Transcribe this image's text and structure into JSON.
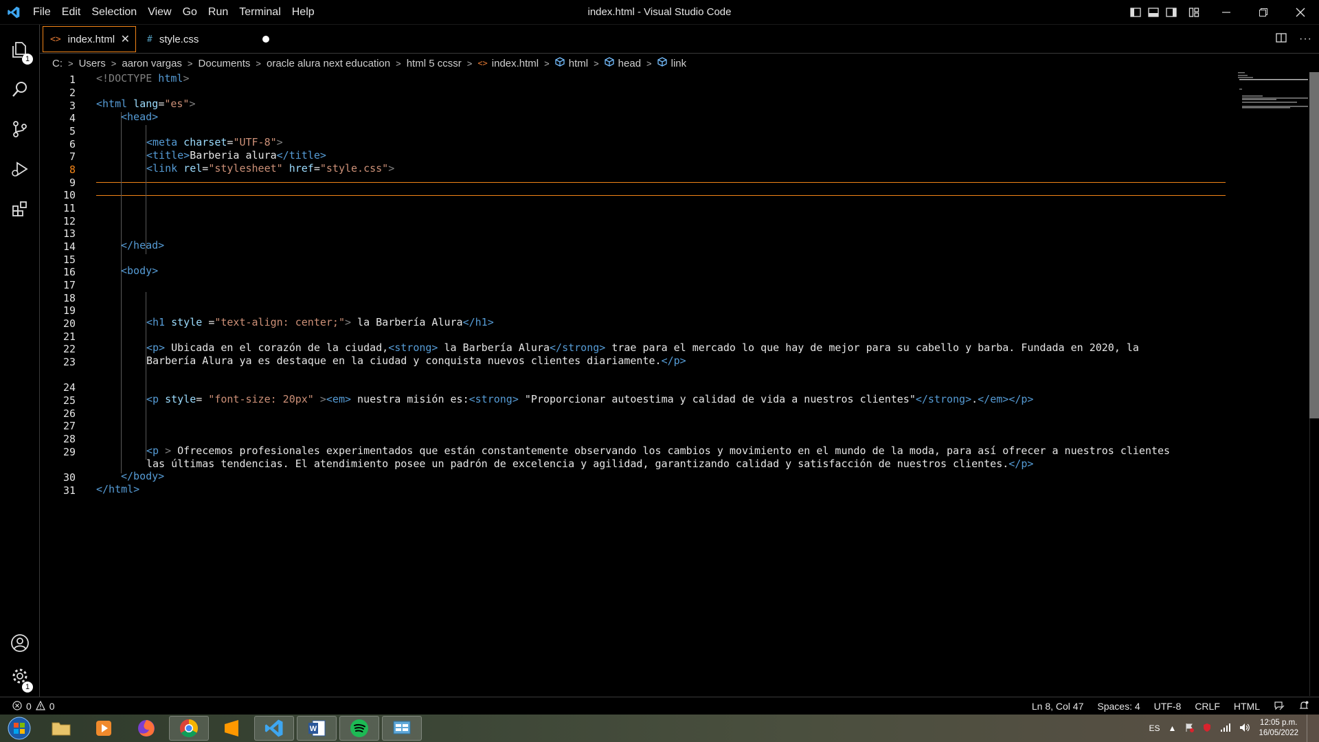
{
  "window": {
    "title": "index.html - Visual Studio Code"
  },
  "menu": [
    "File",
    "Edit",
    "Selection",
    "View",
    "Go",
    "Run",
    "Terminal",
    "Help"
  ],
  "activity": {
    "explorer_badge": "1",
    "settings_badge": "1"
  },
  "tabs": [
    {
      "label": "index.html",
      "icon": "<>",
      "active": true
    },
    {
      "label": "style.css",
      "icon": "#",
      "modified": true
    }
  ],
  "breadcrumb": [
    "C:",
    "Users",
    "aaron vargas",
    "Documents",
    "oracle alura next education",
    "html 5 ccssr",
    "index.html",
    "html",
    "head",
    "link"
  ],
  "code": {
    "line_numbers": [
      "1",
      "2",
      "3",
      "4",
      "5",
      "6",
      "7",
      "8",
      "9",
      "10",
      "11",
      "12",
      "13",
      "14",
      "15",
      "16",
      "17",
      "18",
      "19",
      "20",
      "21",
      "22",
      "23",
      "",
      "24",
      "25",
      "26",
      "27",
      "28",
      "29",
      "",
      "30",
      "31"
    ],
    "l1": {
      "open": "<!DOCTYPE",
      "name": " html",
      "close": ">"
    },
    "l3": {
      "tag": "<html",
      "attr": " lang",
      "eq": "=",
      "val": "\"es\"",
      "close": ">"
    },
    "l4": "<head>",
    "l6": {
      "tag": "<meta",
      "attr": " charset",
      "eq": "=",
      "val": "\"UTF-8\"",
      "close": ">"
    },
    "l7": {
      "open": "<title>",
      "text": "Barberia alura",
      "close": "</title>"
    },
    "l8": {
      "tag": "<link",
      "a1": " rel",
      "eq1": "=",
      "v1": "\"stylesheet\"",
      "a2": " href",
      "eq2": "=",
      "v2": "\"style.css\"",
      "close": ">"
    },
    "l15": "</head>",
    "l17": "<body>",
    "l21": {
      "tag": "<h1",
      "attr": " style ",
      "eq": "=",
      "val": "\"text-align: center;\"",
      "close": ">",
      "text": " la Barbería Alura",
      "end": "</h1>"
    },
    "l23a": {
      "open": "<p>",
      "t1": " Ubicada en el corazón de la ciudad,",
      "s_open": "<strong>",
      "t2": " la Barbería Alura",
      "s_close": "</strong>",
      "t3": " trae para el mercado lo que hay de mejor para su cabello y barba. Fundada en 2020, la"
    },
    "l23b": {
      "text": "Barbería Alura ya es destaque en la ciudad y conquista nuevos clientes diariamente.",
      "close": "</p>"
    },
    "l25": {
      "tag": "<p",
      "attr": " style",
      "eq": "=",
      "val": " \"font-size: 20px\"",
      "close": " >",
      "em": "<em>",
      "t1": " nuestra misión es:",
      "strong": "<strong>",
      "t2": " \"Proporcionar autoestima y calidad de vida a nuestros clientes\"",
      "s_close": "</strong>",
      "dot": ".",
      "em_close": "</em>",
      "p_close": "</p>"
    },
    "l29a": {
      "tag": "<p",
      "close": " >",
      "text": " Ofrecemos profesionales experimentados que están constantemente observando los cambios y movimiento en el mundo de la moda, para así ofrecer a nuestros clientes"
    },
    "l29b": {
      "text": "las últimas tendencias. El atendimiento posee un padrón de excelencia y agilidad, garantizando calidad y satisfacción de nuestros clientes.",
      "close": "</p>"
    },
    "l30": "</body>",
    "l31": "</html>"
  },
  "status": {
    "errors": "0",
    "warnings": "0",
    "position": "Ln 8, Col 47",
    "spaces": "Spaces: 4",
    "encoding": "UTF-8",
    "eol": "CRLF",
    "language": "HTML"
  },
  "taskbar": {
    "lang": "ES",
    "time": "12:05 p.m.",
    "date": "16/05/2022"
  },
  "colors": {
    "accent": "#f38518",
    "tag": "#569cd6",
    "attr": "#9cdcfe",
    "string": "#ce9178"
  }
}
